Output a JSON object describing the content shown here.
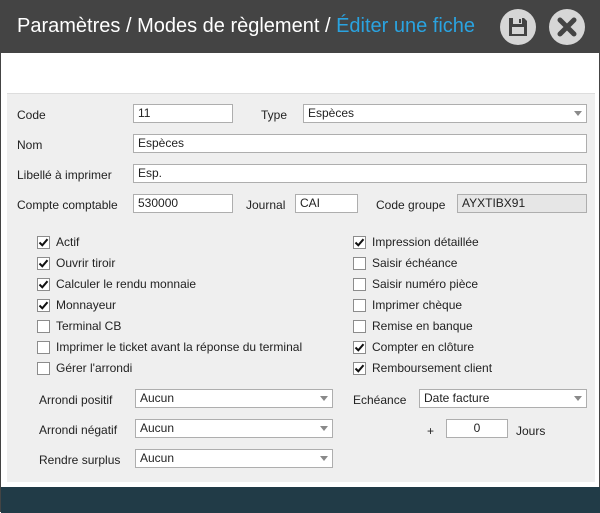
{
  "window": {
    "breadcrumb_1": "Paramètres",
    "sep": "/",
    "breadcrumb_2": "Modes de règlement",
    "breadcrumb_3": "Éditer une fiche",
    "save_icon": "floppy-disk-icon",
    "close_icon": "close-x-icon"
  },
  "colors": {
    "titlebar": "#444444",
    "accent": "#2aa3e0",
    "panel": "#efefef",
    "footer": "#213b47"
  },
  "form": {
    "code": {
      "label": "Code",
      "value": "11"
    },
    "type": {
      "label": "Type",
      "value": "Espèces"
    },
    "nom": {
      "label": "Nom",
      "value": "Espèces"
    },
    "libelle": {
      "label": "Libellé à imprimer",
      "value": "Esp."
    },
    "compte": {
      "label": "Compte comptable",
      "value": "530000"
    },
    "journal": {
      "label": "Journal",
      "value": "CAI"
    },
    "code_groupe": {
      "label": "Code groupe",
      "value": "AYXTIBX91"
    }
  },
  "checkboxes_left": [
    {
      "label": "Actif",
      "checked": true
    },
    {
      "label": "Ouvrir tiroir",
      "checked": true
    },
    {
      "label": "Calculer le rendu monnaie",
      "checked": true
    },
    {
      "label": "Monnayeur",
      "checked": true
    },
    {
      "label": "Terminal CB",
      "checked": false
    },
    {
      "label": "Imprimer le ticket avant la réponse du terminal",
      "checked": false
    },
    {
      "label": "Gérer l'arrondi",
      "checked": false
    }
  ],
  "checkboxes_right": [
    {
      "label": "Impression détaillée",
      "checked": true
    },
    {
      "label": "Saisir échéance",
      "checked": false
    },
    {
      "label": "Saisir numéro pièce",
      "checked": false
    },
    {
      "label": "Imprimer chèque",
      "checked": false
    },
    {
      "label": "Remise en banque",
      "checked": false
    },
    {
      "label": "Compter en clôture",
      "checked": true
    },
    {
      "label": "Remboursement client",
      "checked": true
    }
  ],
  "rounding": {
    "positif": {
      "label": "Arrondi positif",
      "value": "Aucun"
    },
    "negatif": {
      "label": "Arrondi négatif",
      "value": "Aucun"
    },
    "surplus": {
      "label": "Rendre surplus",
      "value": "Aucun"
    }
  },
  "echeance": {
    "label": "Echéance",
    "value": "Date facture",
    "plus": "+",
    "days_value": "0",
    "days_label": "Jours"
  }
}
